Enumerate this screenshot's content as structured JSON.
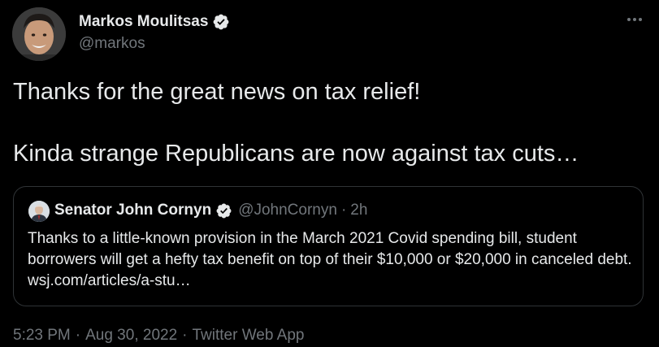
{
  "author": {
    "name": "Markos Moulitsas",
    "handle": "@markos",
    "verified_icon": "verified-badge-icon"
  },
  "more_icon": "more-options-icon",
  "tweet": {
    "line1": "Thanks for the great news on tax relief!",
    "line2": "Kinda strange Republicans are now against tax cuts…"
  },
  "quote": {
    "name": "Senator John Cornyn",
    "handle": "@JohnCornyn",
    "separator": "·",
    "time": "2h",
    "text": "Thanks to a little-known provision in the March 2021 Covid spending bill, student borrowers will get a hefty tax benefit on top of their $10,000 or $20,000 in canceled debt. wsj.com/articles/a-stu…"
  },
  "meta": {
    "time": "5:23 PM",
    "date": "Aug 30, 2022",
    "source": "Twitter Web App",
    "separator": "·"
  },
  "colors": {
    "background": "#000000",
    "text": "#e7e9ea",
    "secondary_text": "#71767b",
    "border": "#2f3336",
    "verified_badge": "#e7e9ea"
  }
}
